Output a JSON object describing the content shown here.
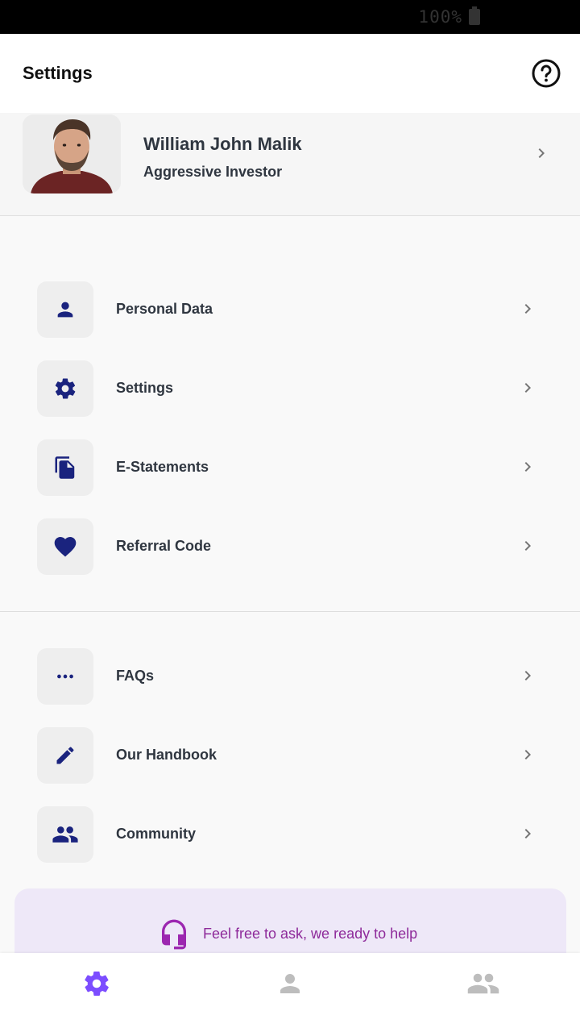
{
  "status_bar": {
    "battery_text": "100%"
  },
  "app_bar": {
    "title": "Settings",
    "help_icon": "help-circle-icon"
  },
  "profile": {
    "name": "William John Malik",
    "subtitle": "Aggressive Investor"
  },
  "menu_groups": [
    [
      {
        "label": "Personal Data",
        "icon": "person-icon"
      },
      {
        "label": "Settings",
        "icon": "gear-icon"
      },
      {
        "label": "E-Statements",
        "icon": "document-icon"
      },
      {
        "label": "Referral Code",
        "icon": "heart-icon"
      }
    ],
    [
      {
        "label": "FAQs",
        "icon": "more-dots-icon"
      },
      {
        "label": "Our Handbook",
        "icon": "pencil-icon"
      },
      {
        "label": "Community",
        "icon": "group-icon"
      }
    ]
  ],
  "help_card": {
    "text": "Feel free to ask, we ready to help",
    "icon": "headset-icon"
  },
  "bottom_nav": [
    {
      "name": "settings",
      "icon": "gear-icon",
      "active": true
    },
    {
      "name": "profile",
      "icon": "person-icon",
      "active": false
    },
    {
      "name": "community",
      "icon": "group-icon",
      "active": false
    }
  ],
  "colors": {
    "icon_navy": "#1a237e",
    "text_dark": "#2f3640",
    "chevron": "#757575",
    "accent_purple": "#7c4dff",
    "help_magenta": "#8e2a9a",
    "help_card_bg": "#eee8f8",
    "nav_inactive": "#bdbdbd"
  }
}
